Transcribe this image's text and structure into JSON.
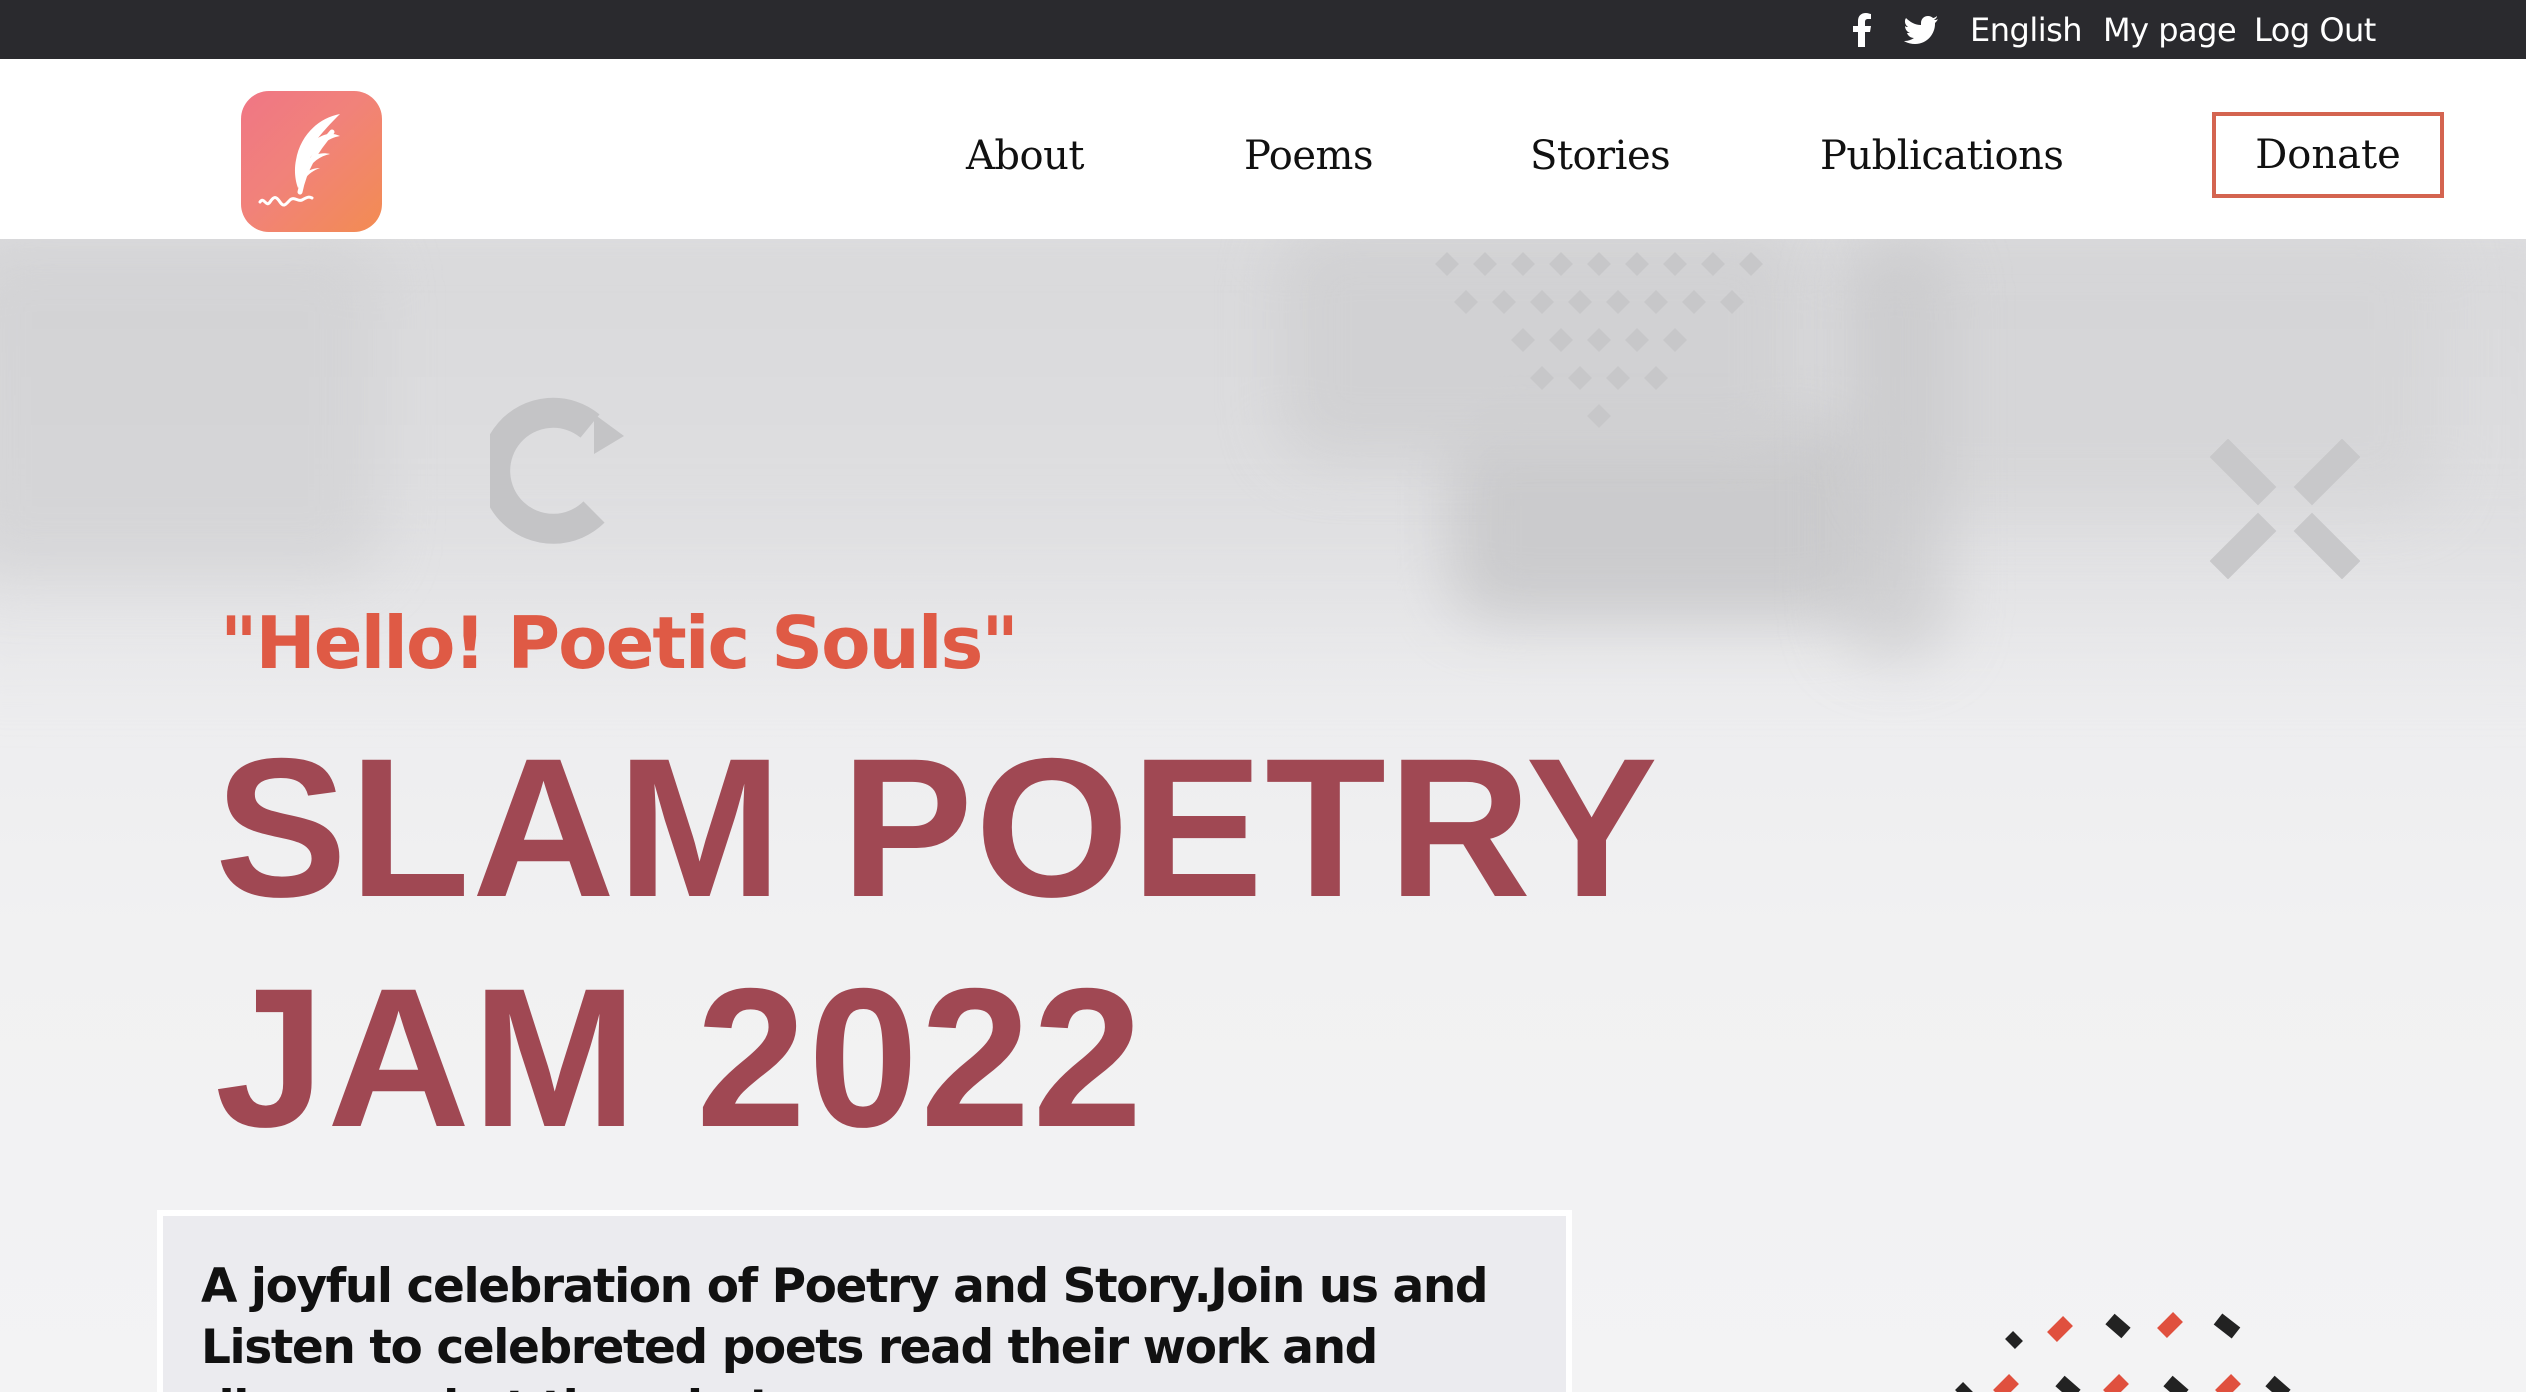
{
  "topbar": {
    "icons": [
      "facebook-icon",
      "twitter-icon"
    ],
    "language": "English",
    "my_page": "My page",
    "log_out": "Log Out"
  },
  "header": {
    "logo_icon": "feather-quill-icon",
    "nav": {
      "about": "About",
      "poems": "Poems",
      "stories": "Stories",
      "publications": "Publications"
    },
    "donate": "Donate"
  },
  "hero": {
    "greeting": "\"Hello! Poetic Souls\"",
    "title_line1": "SLAM POETRY",
    "title_line2": "JAM 2022",
    "description": "A joyful celebration of Poetry and Story.Join us and Listen to celebreted poets read their work and discuss what they do !"
  },
  "colors": {
    "topbar_bg": "#2a2a2e",
    "accent": "#df5a45",
    "title": "#a04853",
    "donate_border": "#d46450"
  }
}
